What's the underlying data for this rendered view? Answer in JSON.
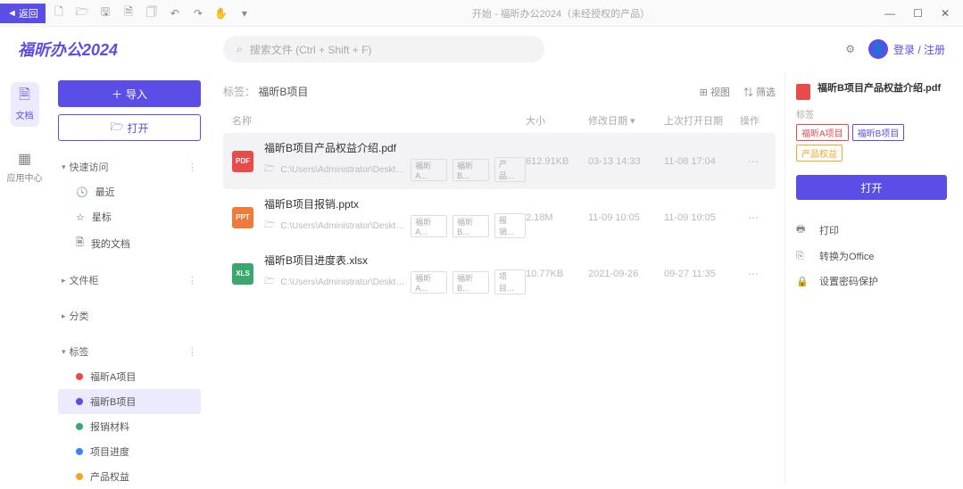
{
  "titlebar": {
    "back": "返回",
    "title": "开始 - 福昕办公2024（未经授权的产品）"
  },
  "brand": "福昕办公2024",
  "search": {
    "placeholder": "搜索文件 (Ctrl + Shift + F)"
  },
  "login": "登录 / 注册",
  "rail": {
    "docs": "文档",
    "apps": "应用中心"
  },
  "sidebar": {
    "import": "导入",
    "open": "打开",
    "quick": "快速访问",
    "quick_items": [
      {
        "icon": "🕓",
        "label": "最近"
      },
      {
        "icon": "☆",
        "label": "星标"
      },
      {
        "icon": "🗎",
        "label": "我的文档"
      }
    ],
    "cabinet": "文件柜",
    "category": "分类",
    "tags": "标签",
    "tag_items": [
      {
        "color": "#e94b4b",
        "label": "福昕A项目"
      },
      {
        "color": "#5b4ee6",
        "label": "福昕B项目",
        "active": true
      },
      {
        "color": "#3aa76d",
        "label": "报销材料"
      },
      {
        "color": "#3b82f6",
        "label": "项目进度"
      },
      {
        "color": "#f5a623",
        "label": "产品权益"
      }
    ]
  },
  "filelist": {
    "breadcrumb_label": "标签：",
    "breadcrumb_value": "福昕B项目",
    "view": "视图",
    "filter": "筛选",
    "cols": {
      "name": "名称",
      "size": "大小",
      "mod": "修改日期",
      "open": "上次打开日期",
      "act": "操作"
    },
    "rows": [
      {
        "type": "pdf",
        "name": "福昕B项目产品权益介绍.pdf",
        "path": "C:\\Users\\Administrator\\Deskto...",
        "chips": [
          "福昕A...",
          "福昕B...",
          "产品..."
        ],
        "size": "612.91KB",
        "mod": "03-13 14:33",
        "open": "11-08 17:04",
        "active": true
      },
      {
        "type": "pptx",
        "name": "福昕B项目报销.pptx",
        "path": "C:\\Users\\Administrator\\Deskto...",
        "chips": [
          "福昕A...",
          "福昕B...",
          "报销..."
        ],
        "size": "2.18M",
        "mod": "11-09 10:05",
        "open": "11-09 10:05"
      },
      {
        "type": "xlsx",
        "name": "福昕B项目进度表.xlsx",
        "path": "C:\\Users\\Administrator\\Deskto...",
        "chips": [
          "福昕A...",
          "福昕B...",
          "项目..."
        ],
        "size": "10.77KB",
        "mod": "2021-09-26",
        "open": "09-27 11:35"
      }
    ]
  },
  "detail": {
    "title": "福昕B项目产品权益介绍.pdf",
    "tag_label": "标签",
    "tags": [
      {
        "label": "福昕A项目",
        "color": "#e94b4b"
      },
      {
        "label": "福昕B项目",
        "color": "#5b4ee6"
      },
      {
        "label": "产品权益",
        "color": "#f5a623"
      }
    ],
    "open": "打开",
    "actions": [
      {
        "icon": "🖶",
        "label": "打印"
      },
      {
        "icon": "⎘",
        "label": "转换为Office"
      },
      {
        "icon": "🔒",
        "label": "设置密码保护"
      }
    ]
  }
}
